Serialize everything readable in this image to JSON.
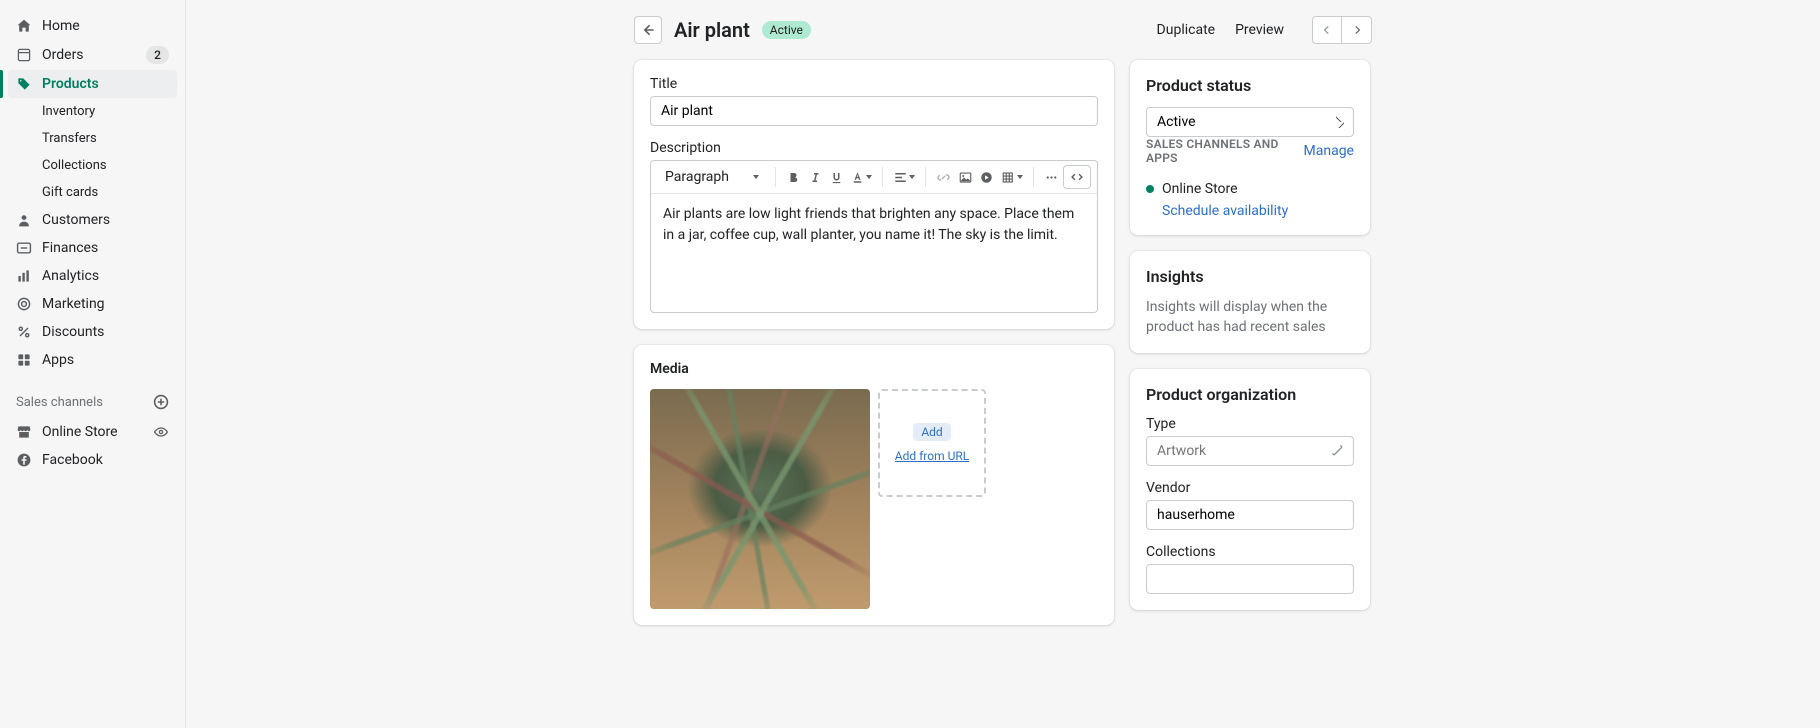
{
  "nav": {
    "home": "Home",
    "orders": "Orders",
    "orders_badge": "2",
    "products": "Products",
    "inventory": "Inventory",
    "transfers": "Transfers",
    "collections": "Collections",
    "gift_cards": "Gift cards",
    "customers": "Customers",
    "finances": "Finances",
    "analytics": "Analytics",
    "marketing": "Marketing",
    "discounts": "Discounts",
    "apps": "Apps",
    "sales_channels": "Sales channels",
    "online_store": "Online Store",
    "facebook": "Facebook"
  },
  "header": {
    "title": "Air plant",
    "badge": "Active",
    "duplicate": "Duplicate",
    "preview": "Preview"
  },
  "form": {
    "title_label": "Title",
    "title_value": "Air plant",
    "desc_label": "Description",
    "para_label": "Paragraph",
    "desc_value": "Air plants are low light friends that brighten any space. Place them in a jar, coffee cup, wall planter, you name it! The sky is the limit."
  },
  "media": {
    "heading": "Media",
    "add": "Add",
    "add_url": "Add from URL"
  },
  "status": {
    "heading": "Product status",
    "value": "Active",
    "channels_label": "Sales channels and apps",
    "manage": "Manage",
    "online_store": "Online Store",
    "schedule": "Schedule availability"
  },
  "insights": {
    "heading": "Insights",
    "text": "Insights will display when the product has had recent sales"
  },
  "org": {
    "heading": "Product organization",
    "type_label": "Type",
    "type_placeholder": "Artwork",
    "vendor_label": "Vendor",
    "vendor_value": "hauserhome",
    "collections_label": "Collections"
  }
}
